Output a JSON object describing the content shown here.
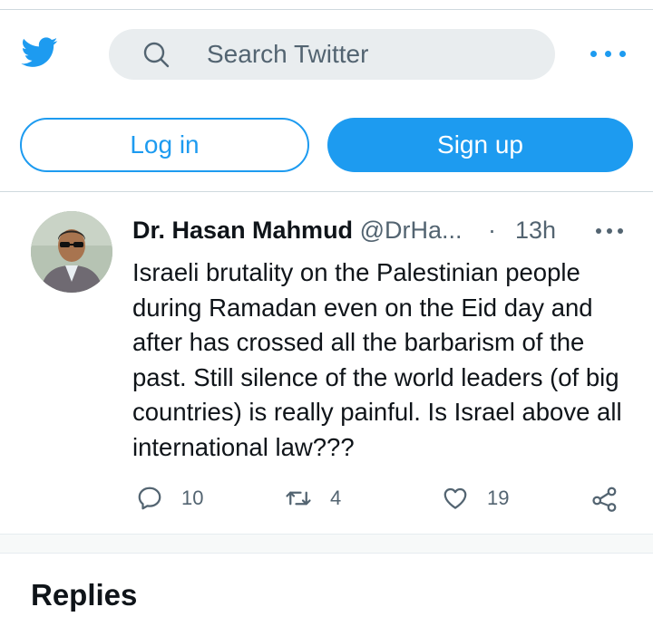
{
  "header": {
    "search": {
      "placeholder": "Search Twitter",
      "icon": "search-icon"
    },
    "brand_color": "#1d9bf0"
  },
  "auth": {
    "login_label": "Log in",
    "signup_label": "Sign up"
  },
  "tweet": {
    "author_name": "Dr. Hasan Mahmud",
    "handle": "@DrHa...",
    "separator": "·",
    "time": "13h",
    "text": "Israeli brutality on the Palestinian people during Ramadan even on the Eid day and after has crossed all the barbarism of the past. Still silence of the world leaders (of big countries) is really painful. Is Israel above all international law???",
    "stats": {
      "replies": "10",
      "retweets": "4",
      "likes": "19"
    }
  },
  "section": {
    "replies_title": "Replies"
  }
}
